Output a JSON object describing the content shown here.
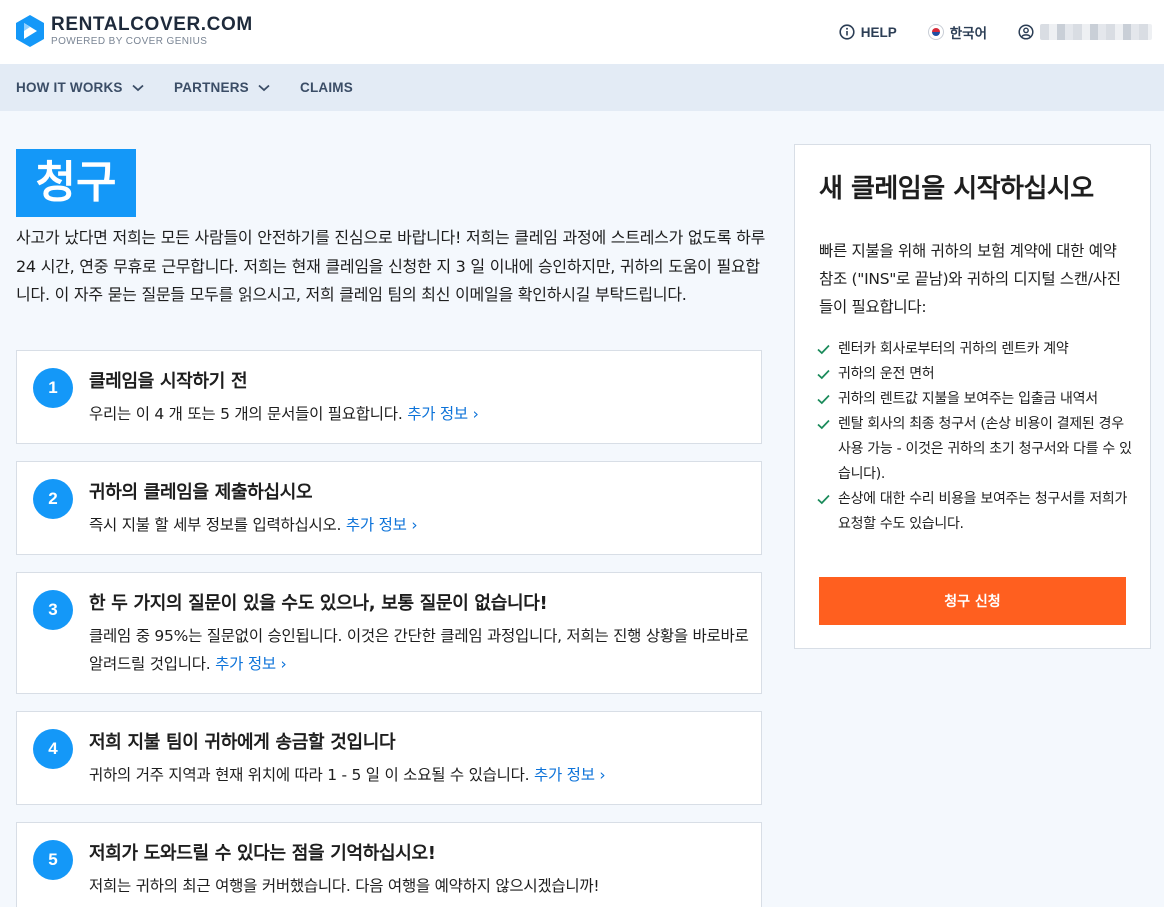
{
  "header": {
    "brand_name": "RENTALCOVER.COM",
    "brand_tagline": "POWERED BY COVER GENIUS",
    "help_label": "HELP",
    "language_label": "한국어",
    "brand_color": "#1498f8"
  },
  "nav": {
    "items": [
      {
        "label": "HOW IT WORKS",
        "has_dropdown": true
      },
      {
        "label": "PARTNERS",
        "has_dropdown": true
      },
      {
        "label": "CLAIMS",
        "has_dropdown": false
      }
    ]
  },
  "main": {
    "title": "청구",
    "intro": "사고가 났다면 저희는 모든 사람들이 안전하기를 진심으로 바랍니다! 저희는 클레임 과정에 스트레스가 없도록 하루 24 시간, 연중 무휴로 근무합니다. 저희는 현재 클레임을 신청한 지 3 일 이내에 승인하지만, 귀하의 도움이 필요합니다. 이 자주 묻는 질문들 모두를 읽으시고, 저희 클레임 팀의 최신 이메일을 확인하시길 부탁드립니다.",
    "more_label": "추가 정보 ›",
    "steps": [
      {
        "number": "1",
        "title": "클레임을 시작하기 전",
        "description": "우리는 이 4 개 또는 5 개의 문서들이 필요합니다.",
        "more": "추가 정보 ›"
      },
      {
        "number": "2",
        "title": "귀하의 클레임을 제출하십시오",
        "description": "즉시 지불 할 세부 정보를 입력하십시오.",
        "more": "추가 정보 ›"
      },
      {
        "number": "3",
        "title": "한 두 가지의 질문이 있을 수도 있으나, 보통 질문이 없습니다!",
        "description": "클레임 중 95%는 질문없이 승인됩니다. 이것은 간단한 클레임 과정입니다, 저희는 진행 상황을 바로바로 알려드릴 것입니다.",
        "more": "추가 정보 ›"
      },
      {
        "number": "4",
        "title": "저희 지불 팀이 귀하에게 송금할 것입니다",
        "description": "귀하의 거주 지역과 현재 위치에 따라 1 - 5 일 이 소요될 수 있습니다.",
        "more": "추가 정보 ›"
      },
      {
        "number": "5",
        "title": "저희가 도와드릴 수 있다는 점을 기억하십시오!",
        "description": "저희는 귀하의 최근 여행을 커버했습니다. 다음 여행을 예약하지 않으시겠습니까!",
        "more": ""
      }
    ]
  },
  "sidebar": {
    "title": "새 클레임을 시작하십시오",
    "description": "빠른 지불을 위해 귀하의 보험 계약에 대한 예약 참조 (\"INS\"로 끝남)와 귀하의 디지털 스캔/사진들이 필요합니다:",
    "checklist": [
      "렌터카 회사로부터의 귀하의 렌트카 계약",
      "귀하의 운전 면허",
      "귀하의 렌트값 지불을 보여주는 입출금 내역서",
      "렌탈 회사의 최종 청구서 (손상 비용이 결제된 경우 사용 가능 - 이것은 귀하의 초기 청구서와 다를 수 있습니다).",
      "손상에 대한 수리 비용을 보여주는 청구서를 저희가 요청할 수도 있습니다."
    ],
    "cta_label": "청구 신청",
    "cta_color": "#ff5f1f",
    "check_color": "#1a8a5a"
  }
}
